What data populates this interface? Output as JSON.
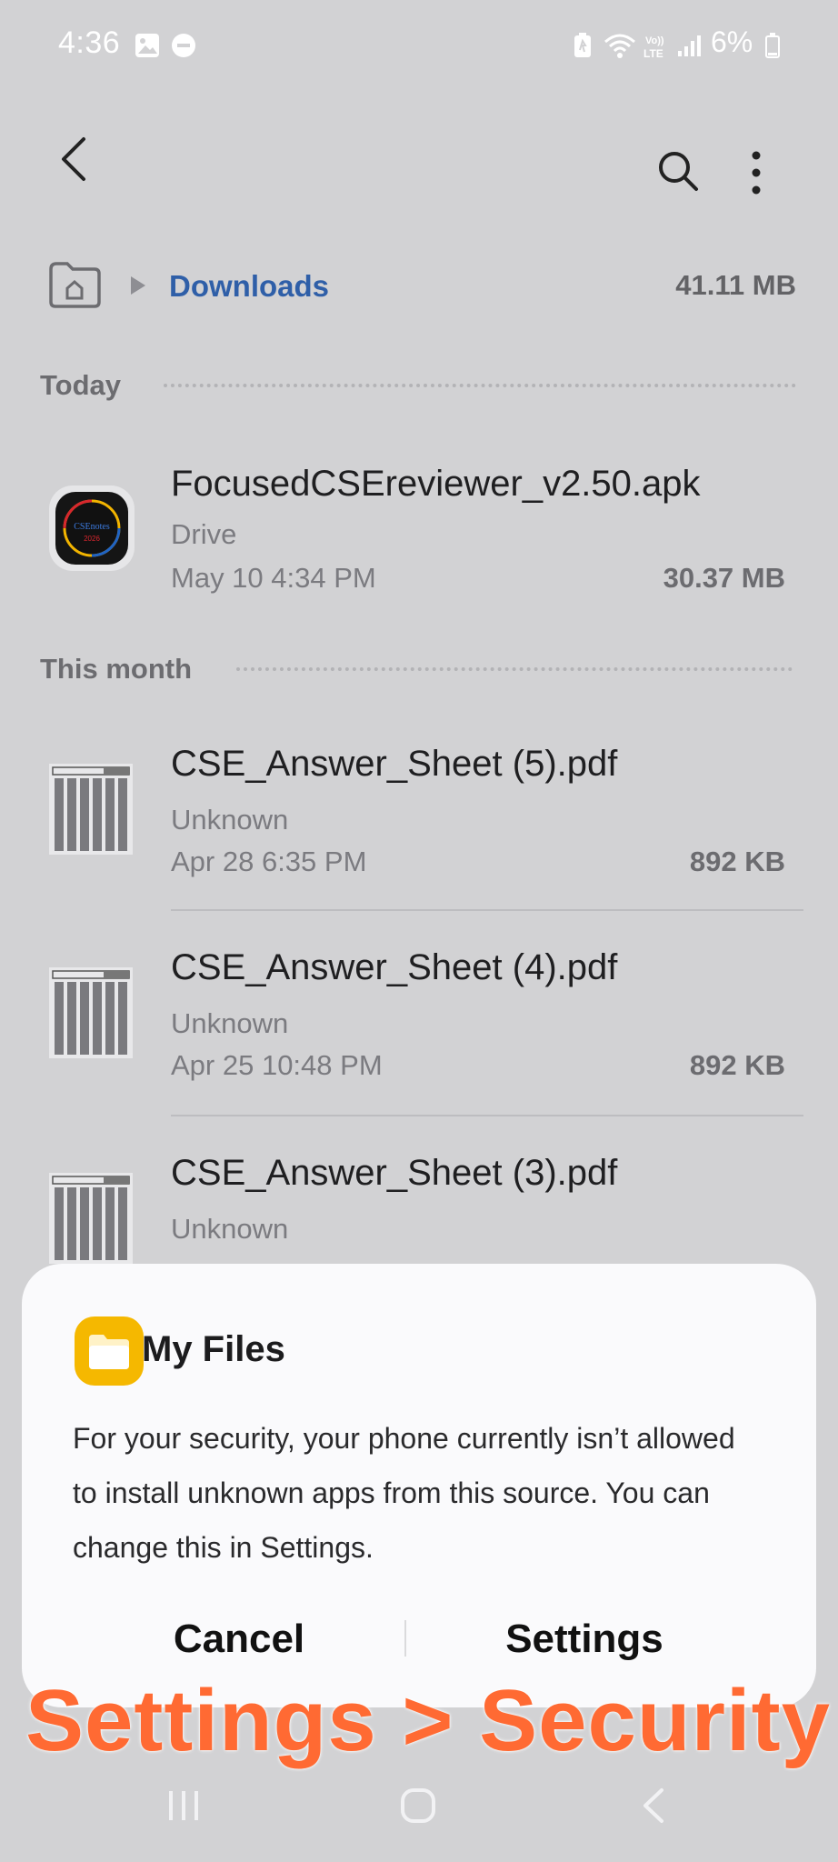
{
  "status_bar": {
    "time": "4:36",
    "battery": "6%",
    "icons": [
      "image-icon",
      "do-not-disturb-icon",
      "battery-saver-icon",
      "wifi-icon",
      "volte-lte-icon",
      "signal-icon",
      "battery-charging-icon"
    ]
  },
  "toolbar": {
    "back_icon": "back-arrow-icon",
    "search_icon": "search-icon",
    "more_icon": "more-options-icon"
  },
  "breadcrumb": {
    "home_icon": "home-folder-icon",
    "current": "Downloads",
    "storage": "41.11 MB"
  },
  "sections": [
    {
      "title": "Today",
      "files": [
        {
          "name": "FocusedCSEreviewer_v2.50.apk",
          "source": "Drive",
          "date": "May 10 4:34 PM",
          "size": "30.37 MB",
          "icon": "app-icon"
        }
      ]
    },
    {
      "title": "This month",
      "files": [
        {
          "name": "CSE_Answer_Sheet (5).pdf",
          "source": "Unknown",
          "date": "Apr 28 6:35 PM",
          "size": "892 KB",
          "icon": "pdf-thumbnail-icon"
        },
        {
          "name": "CSE_Answer_Sheet (4).pdf",
          "source": "Unknown",
          "date": "Apr 25 10:48 PM",
          "size": "892 KB",
          "icon": "pdf-thumbnail-icon"
        },
        {
          "name": "CSE_Answer_Sheet (3).pdf",
          "source": "Unknown",
          "date": "",
          "size": "",
          "icon": "pdf-thumbnail-icon"
        }
      ]
    }
  ],
  "apk_icon_text": {
    "brand": "CSEnotes",
    "year": "2026"
  },
  "dialog": {
    "app_icon": "my-files-folder-icon",
    "title": "My Files",
    "message": "For your security, your phone currently isn’t allowed to install unknown apps from this source. You can change this in Settings.",
    "cancel": "Cancel",
    "settings": "Settings"
  },
  "overlay_caption": "Settings > Security",
  "nav_bar": [
    "recents-icon",
    "home-icon",
    "back-icon"
  ],
  "colors": {
    "background": "#d2d2d4",
    "accent": "#2f5fa8",
    "caption": "#ff6a33",
    "dialog_bg": "#fafafc"
  }
}
